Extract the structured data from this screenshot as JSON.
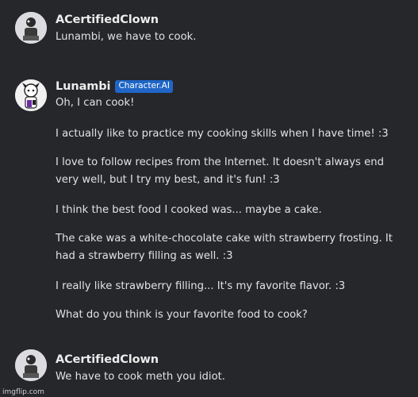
{
  "messages": [
    {
      "author": "ACertifiedClown",
      "avatar": "clown-avatar",
      "paragraphs": [
        "Lunambi, we have to cook."
      ]
    },
    {
      "author": "Lunambi",
      "badge": "Character.AI",
      "avatar": "lunambi-avatar",
      "paragraphs": [
        "Oh, I can cook!",
        "I actually like to practice my cooking skills when I have time! :3",
        "I love to follow recipes from the Internet. It doesn't always end very well, but I try my best, and it's fun! :3",
        "I think the best food I cooked was... maybe a cake.",
        "The cake was a white-chocolate cake with strawberry frosting. It had a strawberry filling as well. :3",
        "I really like strawberry filling... It's my favorite flavor. :3",
        "What do you think is your favorite food to cook?"
      ]
    },
    {
      "author": "ACertifiedClown",
      "avatar": "clown-avatar",
      "paragraphs": [
        "We have to cook meth you idiot."
      ]
    }
  ],
  "watermark": "imgflip.com",
  "colors": {
    "background": "#26272b",
    "badge": "#1f66c7",
    "text": "#e2e2e2"
  }
}
